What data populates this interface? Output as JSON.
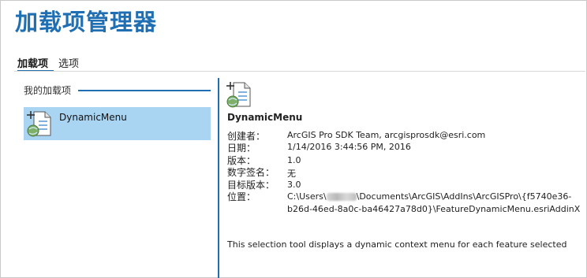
{
  "window": {
    "title": "加载项管理器"
  },
  "tabs": [
    {
      "label": "加载项",
      "active": true
    },
    {
      "label": "选项",
      "active": false
    }
  ],
  "my_addins": {
    "header": "我的加载项",
    "items": [
      {
        "name": "DynamicMenu",
        "icon": "addin-icon",
        "selected": true
      }
    ]
  },
  "details": {
    "icon": "addin-icon",
    "name": "DynamicMenu",
    "properties": [
      {
        "label": "创建者：",
        "value": "ArcGIS Pro SDK Team, arcgisprosdk@esri.com"
      },
      {
        "label": "日期：",
        "value": "1/14/2016 3:44:56 PM, 2016"
      },
      {
        "label": "版本：",
        "value": "1.0"
      },
      {
        "label": "数字签名：",
        "value": "无"
      },
      {
        "label": "目标版本：",
        "value": "3.0"
      }
    ],
    "location": {
      "label": "位置：",
      "prefix": "C:\\Users\\",
      "suffix": "\\Documents\\ArcGIS\\AddIns\\ArcGISPro\\{f5740e36-",
      "line2": "b26d-46ed-8a0c-ba46427a78d0}\\FeatureDynamicMenu.esriAddinX"
    },
    "description": "This selection tool displays a dynamic context menu for each feature selected"
  },
  "colors": {
    "title": "#1f6fb2",
    "accent": "#1f6fb2",
    "selection": "#a9d4f2"
  }
}
